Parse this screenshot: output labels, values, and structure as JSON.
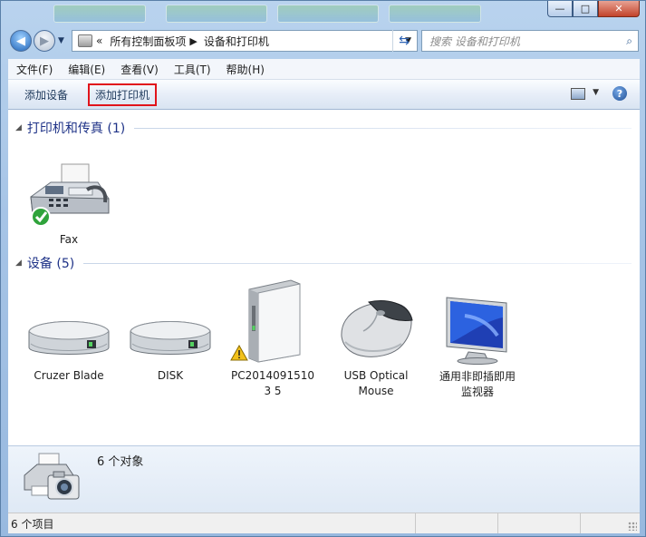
{
  "window": {
    "controls": {
      "minimize": "—",
      "maximize": "□",
      "close": "✕"
    }
  },
  "address": {
    "prefix": "«",
    "crumbs": [
      "所有控制面板项",
      "设备和打印机"
    ],
    "crumb_sep": "▶",
    "search_placeholder": "搜索 设备和打印机"
  },
  "menu": [
    "文件(F)",
    "编辑(E)",
    "查看(V)",
    "工具(T)",
    "帮助(H)"
  ],
  "toolbar": {
    "add_device": "添加设备",
    "add_printer": "添加打印机",
    "help": "?",
    "highlight_color": "#e1141b"
  },
  "groups": {
    "printers": {
      "title": "打印机和传真 (1)",
      "items": [
        {
          "label": "Fax",
          "icon": "fax-icon",
          "status": "default-check"
        }
      ]
    },
    "devices": {
      "title": "设备 (5)",
      "items": [
        {
          "label": "Cruzer Blade",
          "icon": "drive-icon"
        },
        {
          "label": "DISK",
          "icon": "drive-icon"
        },
        {
          "label": "PC20140915103 5",
          "icon": "computer-tower-icon",
          "status": "warning"
        },
        {
          "label": "USB Optical Mouse",
          "icon": "mouse-icon"
        },
        {
          "label": "通用非即插即用监视器",
          "icon": "monitor-icon"
        }
      ]
    }
  },
  "details": {
    "count": "6 个对象",
    "icon": "printer-camera-icon"
  },
  "status": {
    "text": "6 个项目"
  }
}
